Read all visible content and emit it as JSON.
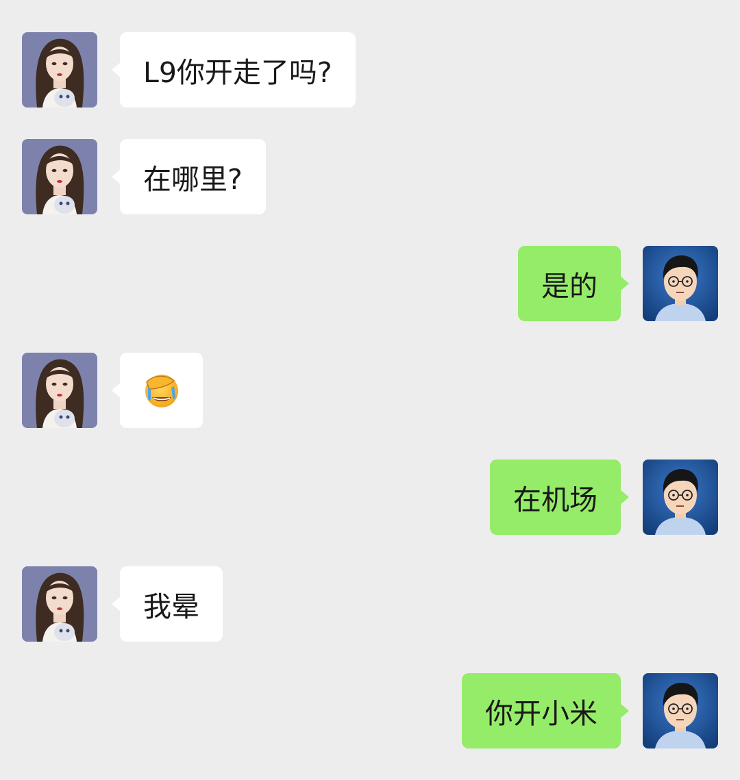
{
  "colors": {
    "background": "#ededed",
    "incoming_bubble": "#ffffff",
    "outgoing_bubble": "#95ec69",
    "text": "#191919"
  },
  "messages": [
    {
      "direction": "incoming",
      "avatar": "woman-avatar",
      "text": "L9你开走了吗?"
    },
    {
      "direction": "incoming",
      "avatar": "woman-avatar",
      "text": "在哪里?"
    },
    {
      "direction": "outgoing",
      "avatar": "man-avatar",
      "text": "是的"
    },
    {
      "direction": "incoming",
      "avatar": "woman-avatar",
      "emoji": "facepalm-laugh-emoji"
    },
    {
      "direction": "outgoing",
      "avatar": "man-avatar",
      "text": "在机场"
    },
    {
      "direction": "incoming",
      "avatar": "woman-avatar",
      "text": "我晕"
    },
    {
      "direction": "outgoing",
      "avatar": "man-avatar",
      "text": "你开小米"
    }
  ]
}
